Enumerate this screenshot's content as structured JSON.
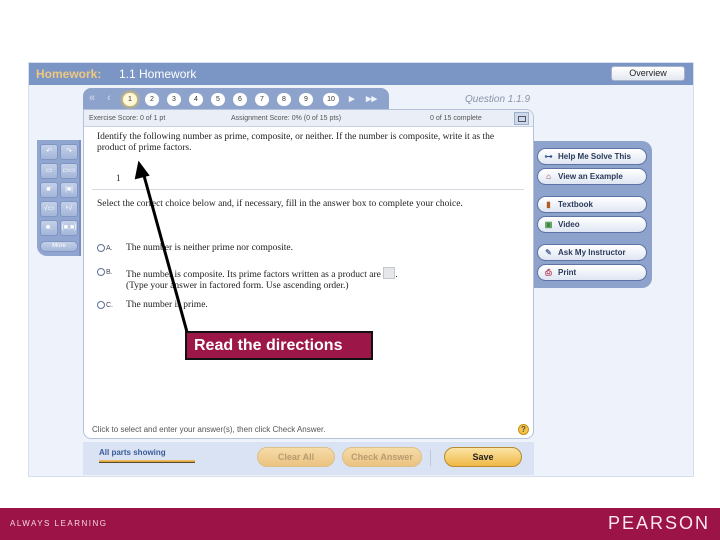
{
  "titlebar": {
    "label": "Homework:",
    "assignment": "1.1 Homework",
    "overview_label": "Overview"
  },
  "question_nav": {
    "first_icon": "double-left-arrow",
    "prev_icon": "left-arrow",
    "next_icon": "right-arrow",
    "last_icon": "double-right-arrow",
    "questions": [
      "1",
      "2",
      "3",
      "4",
      "5",
      "6",
      "7",
      "8",
      "9",
      "10"
    ],
    "active": "1",
    "question_label": "Question 1.1.9"
  },
  "scorebar": {
    "exercise_score": "Exercise Score: 0 of 1 pt",
    "assignment_score": "Assignment Score: 0% (0 of 15 pts)",
    "complete": "0 of 15 complete"
  },
  "question": {
    "prompt": "Identify the following number as prime, composite, or neither. If the number is composite, write it as the product of prime factors.",
    "number": "1",
    "instructions": "Select the correct choice below and, if necessary, fill in the answer box to complete your choice.",
    "choices": [
      {
        "label": "A.",
        "text": "The number is neither prime nor composite."
      },
      {
        "label": "B.",
        "text": "The number is composite. Its prime factors written as a product are",
        "suffix": ".",
        "note": "(Type your answer in factored form. Use ascending order.)"
      },
      {
        "label": "C.",
        "text": "The number is prime."
      }
    ],
    "hint": "Click to select and enter your answer(s), then click Check Answer.",
    "help_glyph": "?"
  },
  "footer": {
    "parts_label": "All parts showing",
    "clear_all": "Clear All",
    "check_answer": "Check Answer",
    "save": "Save"
  },
  "palette": {
    "buttons": [
      "↶",
      "↷",
      "▭",
      "▭▭",
      "■'",
      "|■|",
      "√▭",
      "ⁿ√",
      "■.",
      "(■,■)"
    ],
    "more": "More"
  },
  "help_panel": {
    "items": [
      {
        "icon": "key-icon",
        "glyph": "⊶",
        "color": "#2a4b80",
        "label": "Help Me Solve This"
      },
      {
        "icon": "example-icon",
        "glyph": "⌂",
        "color": "#a82036",
        "label": "View an Example"
      },
      {
        "icon": "textbook-icon",
        "glyph": "▮",
        "color": "#b35a1f",
        "label": "Textbook"
      },
      {
        "icon": "video-icon",
        "glyph": "▣",
        "color": "#3a8a3a",
        "label": "Video"
      },
      {
        "icon": "instructor-icon",
        "glyph": "✎",
        "color": "#5a6e9e",
        "label": "Ask My Instructor"
      },
      {
        "icon": "print-icon",
        "glyph": "⎙",
        "color": "#b03050",
        "label": "Print"
      }
    ]
  },
  "annotation": {
    "callout": "Read the directions"
  },
  "brand": {
    "tagline": "ALWAYS LEARNING",
    "logo": "PEARSON"
  }
}
